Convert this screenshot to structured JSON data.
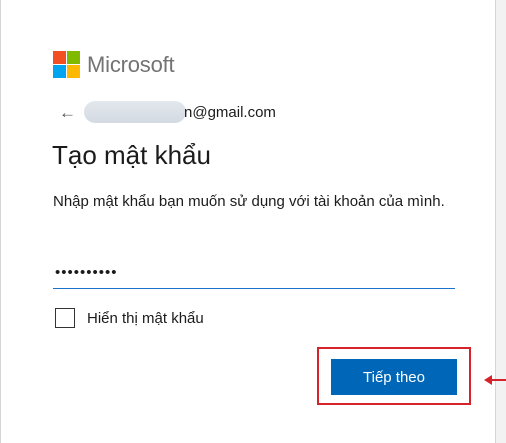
{
  "brand": {
    "name": "Microsoft",
    "logo_colors": [
      "#f25022",
      "#7fba00",
      "#00a4ef",
      "#ffb900"
    ]
  },
  "identity": {
    "back_icon": "←",
    "email_suffix": "n@gmail.com"
  },
  "page": {
    "title": "Tạo mật khẩu",
    "description": "Nhập mật khẩu bạn muốn sử dụng với tài khoản của mình."
  },
  "password_field": {
    "value": "••••••••••"
  },
  "show_password": {
    "label": "Hiển thị mật khẩu",
    "checked": false
  },
  "next_button": {
    "label": "Tiếp theo"
  },
  "annotation": {
    "highlight_color": "#d6232b"
  }
}
